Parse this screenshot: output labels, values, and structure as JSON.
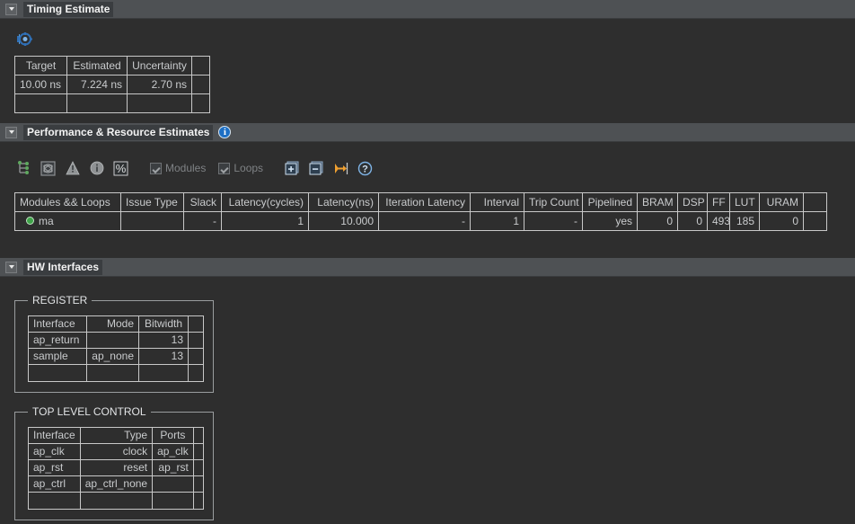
{
  "sections": {
    "timing": {
      "title": "Timing Estimate",
      "twisty_icon": "chevron-down-icon",
      "settings_icon": "gear-icon"
    },
    "performance": {
      "title": "Performance & Resource Estimates",
      "info_icon": "info-icon",
      "twisty_icon": "chevron-down-icon"
    },
    "hw_interfaces": {
      "title": "HW Interfaces",
      "twisty_icon": "chevron-down-icon"
    }
  },
  "timing_table": {
    "headers": [
      "Target",
      "Estimated",
      "Uncertainty",
      ""
    ],
    "rows": [
      [
        "10.00 ns",
        "7.224 ns",
        "2.70 ns",
        ""
      ],
      [
        "",
        "",
        "",
        ""
      ]
    ]
  },
  "perf_toolbar": {
    "buttons": [
      {
        "name": "expand-tree-icon",
        "title": ""
      },
      {
        "name": "collapse-graph-icon",
        "title": ""
      },
      {
        "name": "warning-icon",
        "title": ""
      },
      {
        "name": "info-circle-icon",
        "title": ""
      },
      {
        "name": "percent-icon",
        "title": "%"
      }
    ],
    "checkboxes": [
      {
        "name": "modules-checkbox",
        "label": "Modules",
        "checked": true,
        "enabled": false
      },
      {
        "name": "loops-checkbox",
        "label": "Loops",
        "checked": true,
        "enabled": false
      }
    ],
    "right_buttons": [
      {
        "name": "expand-all-icon",
        "title": "+"
      },
      {
        "name": "collapse-all-icon",
        "title": "-"
      },
      {
        "name": "goto-icon",
        "title": ""
      },
      {
        "name": "help-icon",
        "title": "?"
      }
    ]
  },
  "perf_table": {
    "headers": [
      "Modules && Loops",
      "Issue Type",
      "Slack",
      "Latency(cycles)",
      "Latency(ns)",
      "Iteration Latency",
      "Interval",
      "Trip Count",
      "Pipelined",
      "BRAM",
      "DSP",
      "FF",
      "LUT",
      "URAM",
      ""
    ],
    "rows": [
      {
        "status_icon": "green-status-dot",
        "cells": [
          "ma",
          "",
          "-",
          "1",
          "10.000",
          "-",
          "1",
          "-",
          "yes",
          "0",
          "0",
          "493",
          "185",
          "0",
          ""
        ]
      }
    ]
  },
  "register_group": {
    "legend": "REGISTER",
    "headers": [
      "Interface",
      "Mode",
      "Bitwidth",
      ""
    ],
    "rows": [
      [
        "ap_return",
        "",
        "13",
        ""
      ],
      [
        "sample",
        "ap_none",
        "13",
        ""
      ],
      [
        "",
        "",
        "",
        ""
      ]
    ]
  },
  "top_level_control_group": {
    "legend": "TOP LEVEL CONTROL",
    "headers": [
      "Interface",
      "Type",
      "Ports",
      ""
    ],
    "rows": [
      [
        "ap_clk",
        "clock",
        "ap_clk",
        ""
      ],
      [
        "ap_rst",
        "reset",
        "ap_rst",
        ""
      ],
      [
        "ap_ctrl",
        "ap_ctrl_none",
        "",
        ""
      ],
      [
        "",
        "",
        "",
        ""
      ]
    ]
  },
  "colors": {
    "background": "#2e2e2e",
    "header_bar": "#4e5154",
    "title_highlight": "#3a3d40",
    "grid_border": "#c8c8c8",
    "text": "#c9cbcd",
    "accent_blue": "#1d6fc4",
    "status_green": "#3fa349",
    "accent_orange": "#f0a030"
  }
}
